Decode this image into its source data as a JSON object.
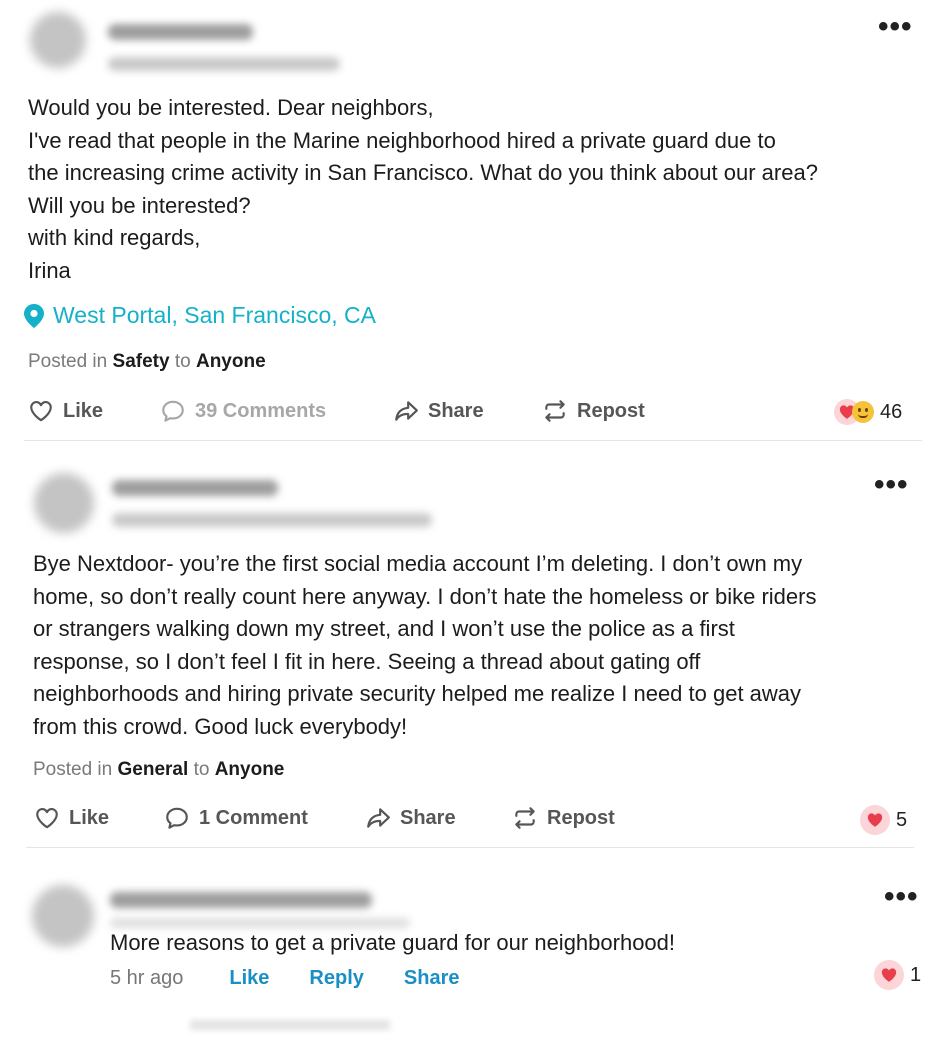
{
  "posts": [
    {
      "body": "Would you be interested. Dear neighbors,\nI've read that people in the Marine neighborhood hired a private guard due to\nthe increasing crime activity in San Francisco. What do you think about our area?\nWill you be interested?\nwith kind regards,\nIrina",
      "location": "West Portal, San Francisco, CA",
      "posted_prefix": "Posted in",
      "category": "Safety",
      "to_word": "to",
      "audience": "Anyone",
      "actions": {
        "like": "Like",
        "comments": "39 Comments",
        "share": "Share",
        "repost": "Repost"
      },
      "reaction_count": "46",
      "reaction_icons": [
        "heart-icon",
        "smirk-emoji-icon"
      ]
    },
    {
      "body": "Bye Nextdoor- you’re the first social media account I’m deleting. I don’t own my\nhome, so don’t really count here anyway. I don’t hate the homeless or bike riders\nor strangers walking down my street, and I won’t use the police as a first\nresponse, so I don’t feel I fit in here. Seeing a thread about gating off\nneighborhoods and hiring private security helped me realize I need to get away\nfrom this crowd. Good luck everybody!",
      "posted_prefix": "Posted in",
      "category": "General",
      "to_word": "to",
      "audience": "Anyone",
      "actions": {
        "like": "Like",
        "comments": "1 Comment",
        "share": "Share",
        "repost": "Repost"
      },
      "reaction_count": "5",
      "reaction_icons": [
        "heart-icon"
      ]
    }
  ],
  "comment": {
    "text": "More reasons to get a private guard for our neighborhood!",
    "time": "5 hr ago",
    "actions": {
      "like": "Like",
      "reply": "Reply",
      "share": "Share"
    },
    "reaction_count": "1"
  },
  "colors": {
    "link": "#14b1c8",
    "action_link": "#1a8fc4",
    "heart": "#e83e4c"
  }
}
